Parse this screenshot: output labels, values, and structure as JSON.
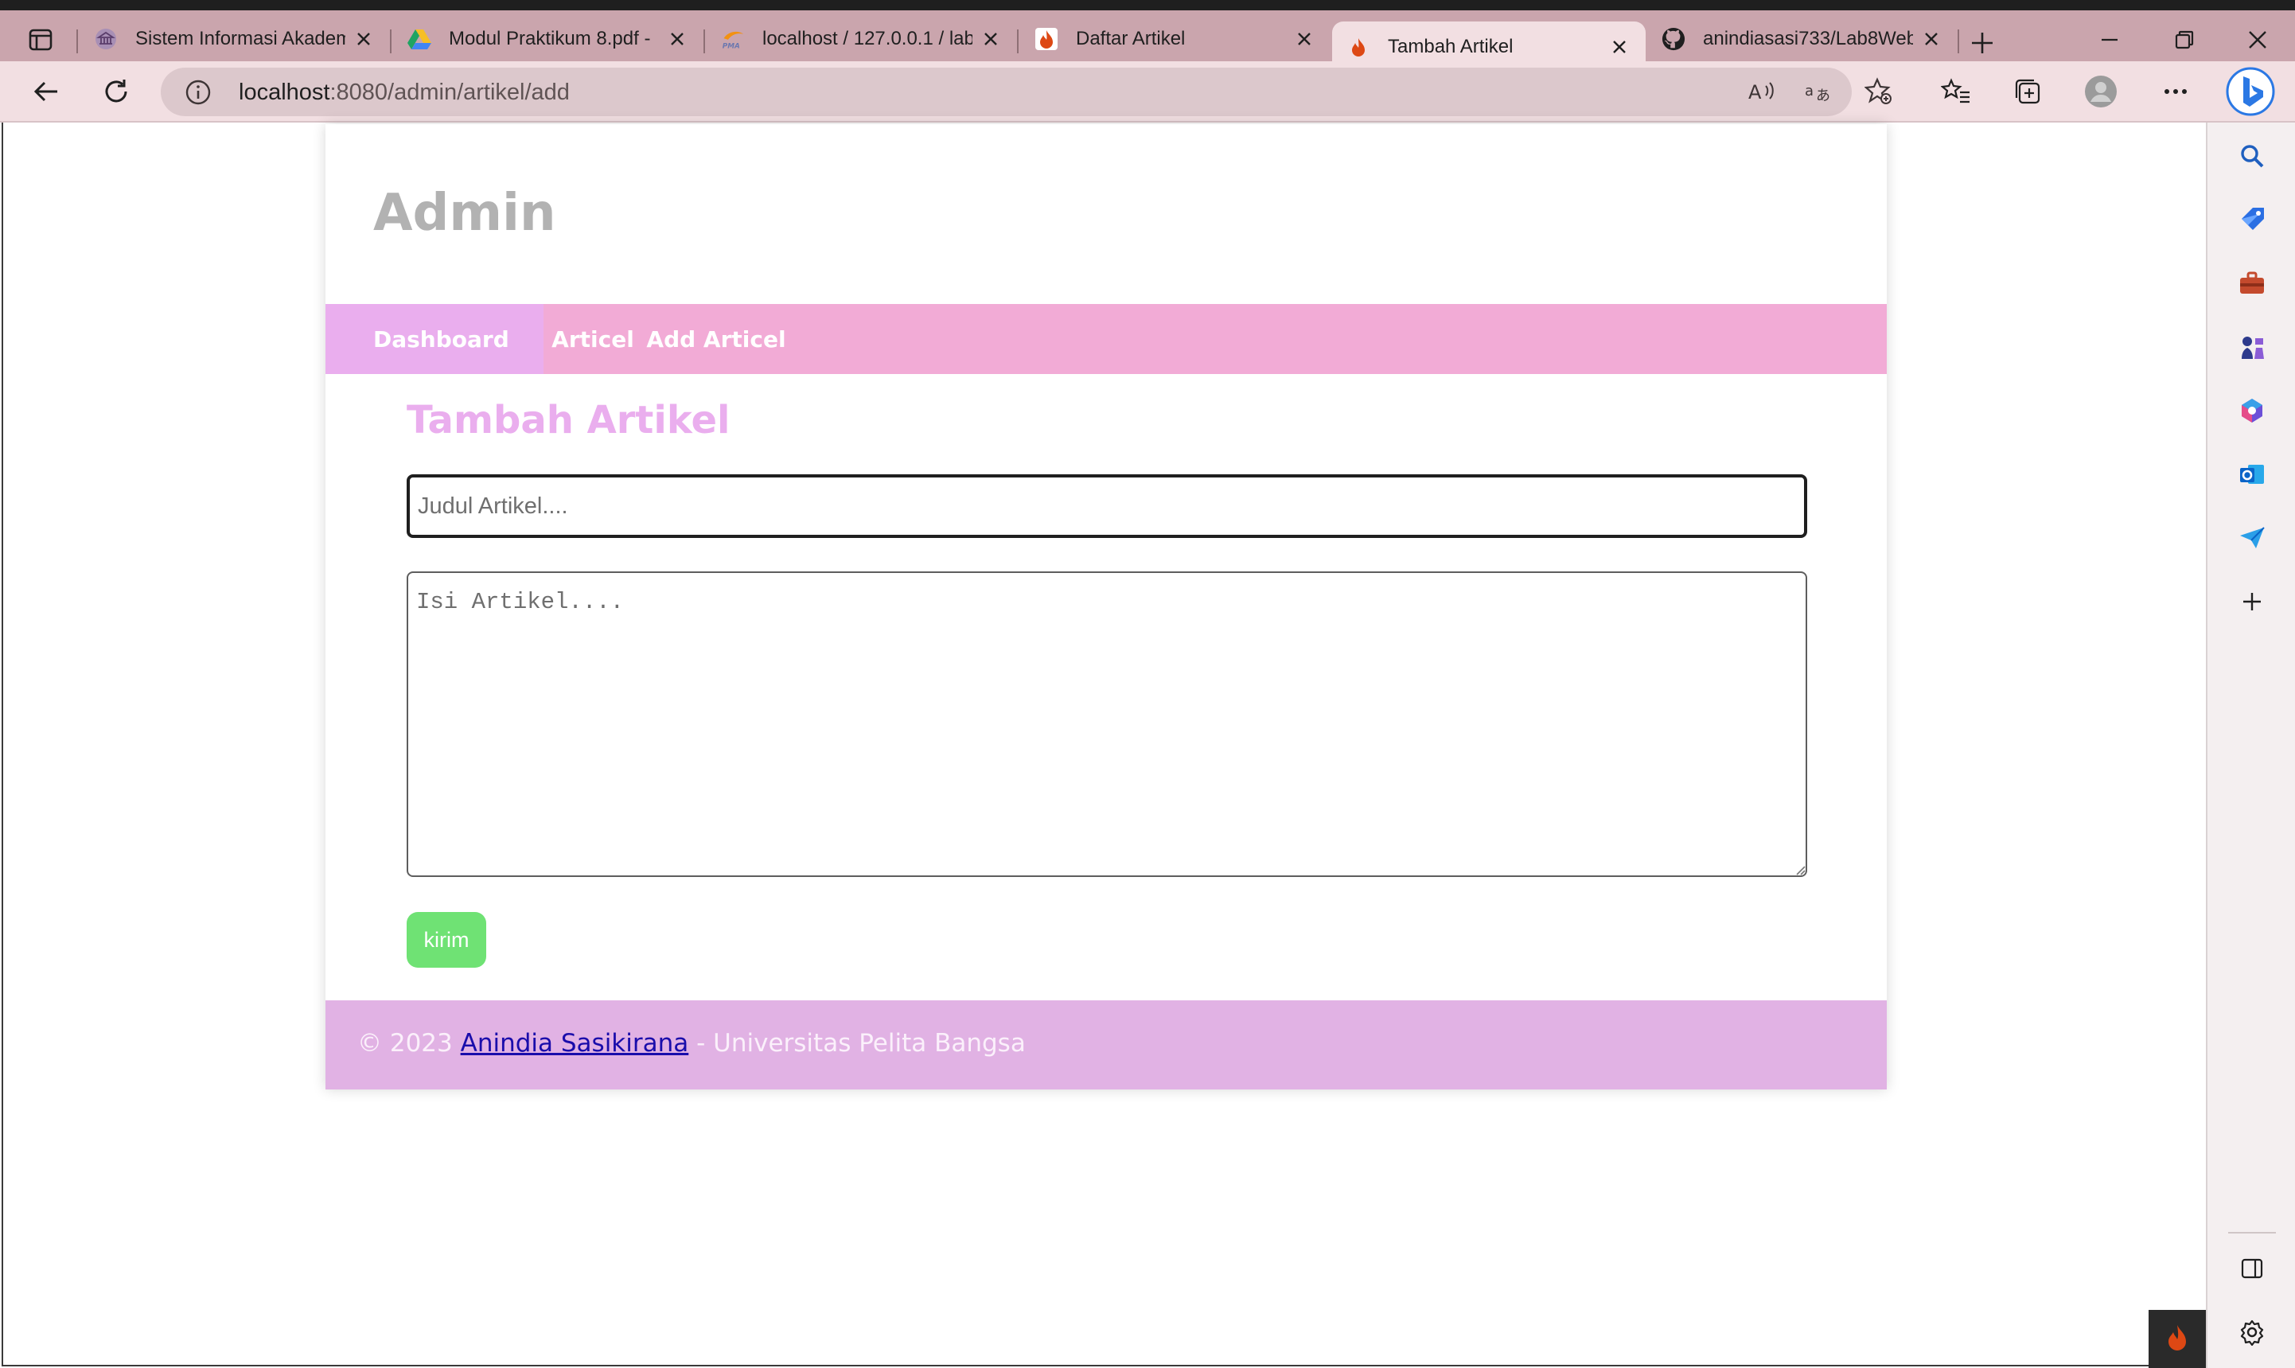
{
  "browser": {
    "tabs": [
      {
        "title": "Sistem Informasi Akadem",
        "favicon": "university-icon",
        "active": false
      },
      {
        "title": "Modul Praktikum 8.pdf -",
        "favicon": "google-drive-icon",
        "active": false
      },
      {
        "title": "localhost / 127.0.0.1 / lab",
        "favicon": "phpmyadmin-icon",
        "active": false
      },
      {
        "title": "Daftar Artikel",
        "favicon": "codeigniter-icon",
        "active": false
      },
      {
        "title": "Tambah Artikel",
        "favicon": "codeigniter-icon",
        "active": true
      },
      {
        "title": "anindiasasi733/Lab8Web",
        "favicon": "github-icon",
        "active": false
      }
    ],
    "address": {
      "host": "localhost",
      "path": ":8080/admin/artikel/add"
    }
  },
  "page": {
    "header_title": "Admin",
    "nav": [
      {
        "label": "Dashboard",
        "active": true
      },
      {
        "label": "Articel",
        "active": false
      },
      {
        "label": "Add Articel",
        "active": false
      }
    ],
    "content_title": "Tambah Artikel",
    "form": {
      "title_placeholder": "Judul Artikel....",
      "body_placeholder": "Isi Artikel....",
      "submit_label": "kirim"
    },
    "footer": {
      "prefix": "© 2023 ",
      "author_link": "Anindia Sasikirana",
      "suffix": " - Universitas Pelita Bangsa"
    }
  },
  "colors": {
    "navbar": "#f2abd6",
    "nav_active": "#eaaeee",
    "title": "#eaaeee",
    "submit": "#6fe274",
    "footer": "#e1b2e4",
    "browser_frame": "#caa5ad"
  }
}
